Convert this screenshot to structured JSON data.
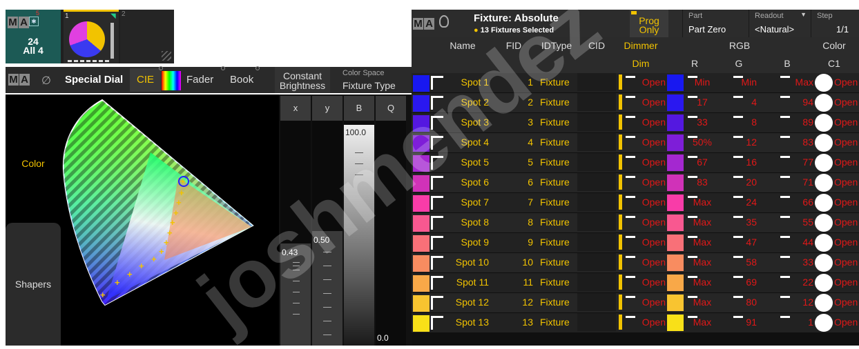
{
  "view_pool": {
    "badge": "5",
    "master_count": "24",
    "master_label": "All 4",
    "view1_number": "1",
    "view2_number": "2"
  },
  "color_picker": {
    "title": "Special Dial",
    "tabs": [
      "CIE",
      "Fader",
      "Book"
    ],
    "active_tab": "CIE",
    "constant_brightness_label": "Constant Brightness",
    "color_space_caption": "Color Space",
    "color_space_value": "Fixture Type",
    "side_color_label": "Color",
    "side_shapers_label": "Shapers",
    "faders": [
      {
        "label": "x",
        "value": "0.43",
        "level": 0.43
      },
      {
        "label": "y",
        "value": "0.50",
        "level": 0.5
      },
      {
        "label": "B",
        "value": "100.0",
        "level": 1.0
      },
      {
        "label": "Q",
        "value": "0.0",
        "level": 0.0
      }
    ]
  },
  "fixture_sheet": {
    "title": "Fixture: Absolute",
    "selected_text": "13 Fixtures Selected",
    "prog_only_label": "Prog Only",
    "part_caption": "Part",
    "part_value": "Part Zero",
    "readout_caption": "Readout",
    "readout_value": "<Natural>",
    "step_caption": "Step",
    "step_value": "1/1",
    "columns": {
      "name": "Name",
      "fid": "FID",
      "idtype": "IDType",
      "cid": "CID",
      "dimmer": "Dimmer",
      "dim": "Dim",
      "rgb": "RGB",
      "r": "R",
      "g": "G",
      "b": "B",
      "color": "Color",
      "c1": "C1"
    },
    "rows": [
      {
        "swatch": "#1818f0",
        "name": "Spot 1",
        "fid": "1",
        "idtype": "Fixture",
        "dimmer": "Open",
        "r": "Min",
        "g": "Min",
        "b": "Max",
        "c1": "Open"
      },
      {
        "swatch": "#2a18f0",
        "name": "Spot 2",
        "fid": "2",
        "idtype": "Fixture",
        "dimmer": "Open",
        "r": "17",
        "g": "4",
        "b": "94",
        "c1": "Open"
      },
      {
        "swatch": "#5418e0",
        "name": "Spot 3",
        "fid": "3",
        "idtype": "Fixture",
        "dimmer": "Open",
        "r": "33",
        "g": "8",
        "b": "89",
        "c1": "Open"
      },
      {
        "swatch": "#7e1ed8",
        "name": "Spot 4",
        "fid": "4",
        "idtype": "Fixture",
        "dimmer": "Open",
        "r": "50%",
        "g": "12",
        "b": "83",
        "c1": "Open"
      },
      {
        "swatch": "#a428d0",
        "name": "Spot 5",
        "fid": "5",
        "idtype": "Fixture",
        "dimmer": "Open",
        "r": "67",
        "g": "16",
        "b": "77",
        "c1": "Open"
      },
      {
        "swatch": "#d032b8",
        "name": "Spot 6",
        "fid": "6",
        "idtype": "Fixture",
        "dimmer": "Open",
        "r": "83",
        "g": "20",
        "b": "71",
        "c1": "Open"
      },
      {
        "swatch": "#f83ca8",
        "name": "Spot 7",
        "fid": "7",
        "idtype": "Fixture",
        "dimmer": "Open",
        "r": "Max",
        "g": "24",
        "b": "66",
        "c1": "Open"
      },
      {
        "swatch": "#f85890",
        "name": "Spot 8",
        "fid": "8",
        "idtype": "Fixture",
        "dimmer": "Open",
        "r": "Max",
        "g": "35",
        "b": "55",
        "c1": "Open"
      },
      {
        "swatch": "#f87078",
        "name": "Spot 9",
        "fid": "9",
        "idtype": "Fixture",
        "dimmer": "Open",
        "r": "Max",
        "g": "47",
        "b": "44",
        "c1": "Open"
      },
      {
        "swatch": "#f88c60",
        "name": "Spot 10",
        "fid": "10",
        "idtype": "Fixture",
        "dimmer": "Open",
        "r": "Max",
        "g": "58",
        "b": "33",
        "c1": "Open"
      },
      {
        "swatch": "#f8a848",
        "name": "Spot 11",
        "fid": "11",
        "idtype": "Fixture",
        "dimmer": "Open",
        "r": "Max",
        "g": "69",
        "b": "22",
        "c1": "Open"
      },
      {
        "swatch": "#f8c430",
        "name": "Spot 12",
        "fid": "12",
        "idtype": "Fixture",
        "dimmer": "Open",
        "r": "Max",
        "g": "80",
        "b": "12",
        "c1": "Open"
      },
      {
        "swatch": "#f8e018",
        "name": "Spot 13",
        "fid": "13",
        "idtype": "Fixture",
        "dimmer": "Open",
        "r": "Max",
        "g": "91",
        "b": "1",
        "c1": "Open"
      }
    ]
  },
  "colors": {
    "accent": "#f2c300",
    "value_red": "#e01818",
    "panel": "#2b2b2b",
    "master_teal": "#1c5a55"
  }
}
